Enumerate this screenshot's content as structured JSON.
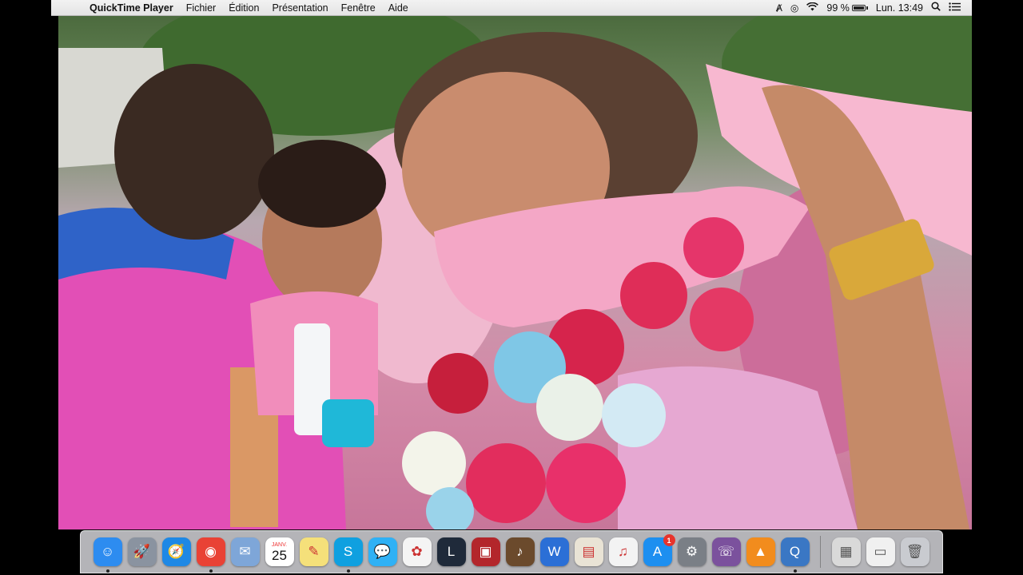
{
  "menubar": {
    "app_name": "QuickTime Player",
    "menus": [
      "Fichier",
      "Édition",
      "Présentation",
      "Fenêtre",
      "Aide"
    ],
    "battery_percent": "99 %",
    "battery_level": 0.99,
    "clock": "Lun. 13:49"
  },
  "dock": {
    "calendar": {
      "month": "JANV.",
      "day": "25"
    },
    "appstore_badge": "1",
    "apps": [
      {
        "name": "finder",
        "glyph": "☺",
        "color": "#2d8cf0",
        "running": true
      },
      {
        "name": "launchpad",
        "glyph": "🚀",
        "color": "#8a93a0",
        "running": false
      },
      {
        "name": "safari",
        "glyph": "🧭",
        "color": "#1e88e5",
        "running": false
      },
      {
        "name": "chrome",
        "glyph": "◉",
        "color": "#e94235",
        "running": true
      },
      {
        "name": "mail",
        "glyph": "✉",
        "color": "#7ea6d8",
        "running": false
      },
      {
        "name": "calendar",
        "glyph": "",
        "color": "#ffffff",
        "running": false
      },
      {
        "name": "notes",
        "glyph": "✎",
        "color": "#f5e07a",
        "running": false
      },
      {
        "name": "skype",
        "glyph": "S",
        "color": "#0fa0e0",
        "running": true
      },
      {
        "name": "messages",
        "glyph": "💬",
        "color": "#2fb1f5",
        "running": false
      },
      {
        "name": "photos",
        "glyph": "✿",
        "color": "#f4f4f4",
        "running": false
      },
      {
        "name": "league",
        "glyph": "L",
        "color": "#1f2a3a",
        "running": false
      },
      {
        "name": "photobooth",
        "glyph": "▣",
        "color": "#b3262b",
        "running": false
      },
      {
        "name": "garageband",
        "glyph": "♪",
        "color": "#6b4a2c",
        "running": false
      },
      {
        "name": "word",
        "glyph": "W",
        "color": "#2b6fd6",
        "running": false
      },
      {
        "name": "preview",
        "glyph": "▤",
        "color": "#e9e3d5",
        "running": false
      },
      {
        "name": "itunes",
        "glyph": "♫",
        "color": "#f3f3f3",
        "running": false
      },
      {
        "name": "appstore",
        "glyph": "A",
        "color": "#1d8ff0",
        "running": false
      },
      {
        "name": "system-preferences",
        "glyph": "⚙",
        "color": "#7a7f86",
        "running": false
      },
      {
        "name": "viber",
        "glyph": "☏",
        "color": "#7b519d",
        "running": false
      },
      {
        "name": "vlc",
        "glyph": "▲",
        "color": "#f28c1d",
        "running": false
      },
      {
        "name": "quicktime",
        "glyph": "Q",
        "color": "#3a77c4",
        "running": true
      }
    ],
    "stacks": [
      {
        "name": "downloads-stack",
        "glyph": "▦",
        "color": "#d9d9d9"
      },
      {
        "name": "documents-stack",
        "glyph": "▭",
        "color": "#f0f0f0"
      },
      {
        "name": "trash",
        "glyph": "🗑",
        "color": "#c9cbd0"
      }
    ]
  }
}
